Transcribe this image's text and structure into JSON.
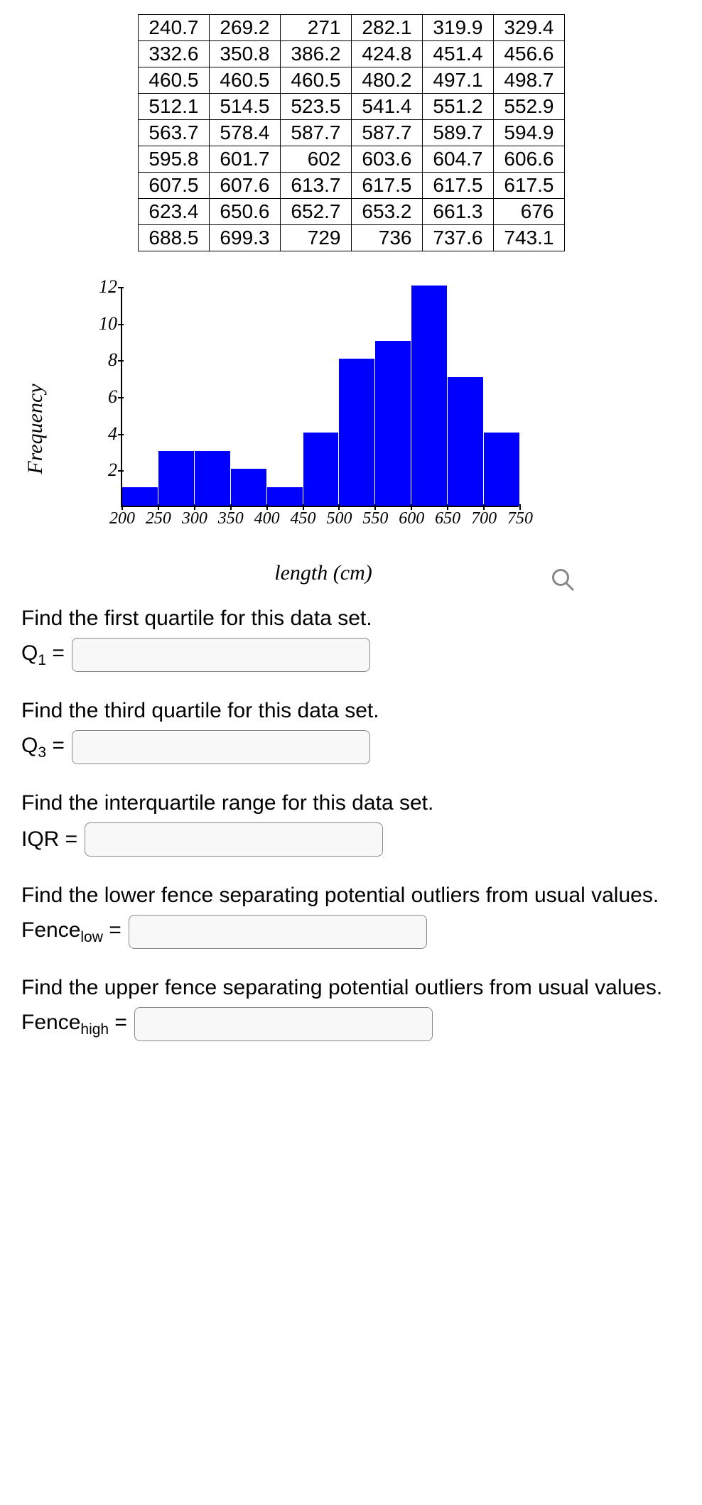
{
  "table": [
    [
      240.7,
      269.2,
      271,
      282.1,
      319.9,
      329.4
    ],
    [
      332.6,
      350.8,
      386.2,
      424.8,
      451.4,
      456.6
    ],
    [
      460.5,
      460.5,
      460.5,
      480.2,
      497.1,
      498.7
    ],
    [
      512.1,
      514.5,
      523.5,
      541.4,
      551.2,
      552.9
    ],
    [
      563.7,
      578.4,
      587.7,
      587.7,
      589.7,
      594.9
    ],
    [
      595.8,
      601.7,
      602,
      603.6,
      604.7,
      606.6
    ],
    [
      607.5,
      607.6,
      613.7,
      617.5,
      617.5,
      617.5
    ],
    [
      623.4,
      650.6,
      652.7,
      653.2,
      661.3,
      676
    ],
    [
      688.5,
      699.3,
      729,
      736,
      737.6,
      743.1
    ]
  ],
  "chart_data": {
    "type": "bar",
    "categories": [
      "200",
      "250",
      "300",
      "350",
      "400",
      "450",
      "500",
      "550",
      "600",
      "650",
      "700",
      "750"
    ],
    "values": [
      1,
      3,
      3,
      2,
      1,
      4,
      8,
      9,
      12,
      7,
      4
    ],
    "xlabel": "length (cm)",
    "ylabel": "Frequency",
    "yticks": [
      2,
      4,
      6,
      8,
      10,
      12
    ],
    "ymax": 12,
    "title": ""
  },
  "questions": {
    "q1": {
      "prompt": "Find the first quartile for this data set.",
      "label_html": "Q<sub>1</sub> ="
    },
    "q3": {
      "prompt": "Find the third quartile for this data set.",
      "label_html": "Q<sub>3</sub> ="
    },
    "iqr": {
      "prompt": "Find the interquartile range for this data set.",
      "label_html": "IQR ="
    },
    "fence_low": {
      "prompt": "Find the lower fence separating potential outliers from usual values.",
      "label_html": "Fence<sub>low</sub> ="
    },
    "fence_high": {
      "prompt": "Find the upper fence separating potential outliers from usual values.",
      "label_html": "Fence<sub>high</sub> ="
    }
  }
}
